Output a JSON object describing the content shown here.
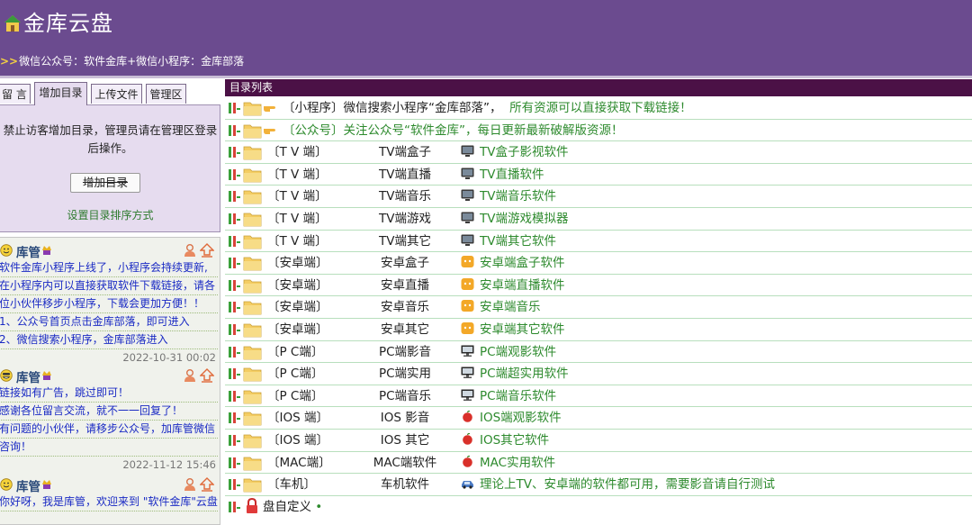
{
  "site": {
    "title": "金库云盘",
    "notice_arrows": ">>",
    "notice": "微信公众号：软件金库+微信小程序：金库部落"
  },
  "tabs": [
    {
      "label": "留 言"
    },
    {
      "label": "增加目录"
    },
    {
      "label": "上传文件"
    },
    {
      "label": "管理区"
    }
  ],
  "panel": {
    "message": "禁止访客增加目录，管理员请在管理区登录后操作。",
    "add_button": "增加目录",
    "sort_link": "设置目录排序方式"
  },
  "comments": [
    {
      "user": "库管",
      "lines": [
        "软件金库小程序上线了，小程序会持续更新,",
        "在小程序内可以直接获取软件下载链接，请各",
        "位小伙伴移步小程序，下载会更加方便！！",
        "1、公众号首页点击金库部落，即可进入",
        "2、微信搜索小程序，金库部落进入"
      ],
      "time": "2022-10-31 00:02"
    },
    {
      "user": "库管",
      "lines": [
        "链接如有广告，跳过即可！",
        "感谢各位留言交流，就不一一回复了！",
        "有问题的小伙伴，请移步公众号，加库管微信",
        "咨询！"
      ],
      "time": "2022-11-12 15:46"
    },
    {
      "user": "库管",
      "lines": [
        "你好呀，我是库管，欢迎来到 \"软件金库\"云盘"
      ],
      "time": ""
    }
  ],
  "list": {
    "header": "目录列表",
    "top_rows": [
      {
        "prefix": "〔小程序〕微信搜索小程序“金库部落”，",
        "suffix": "所有资源可以直接获取下载链接！"
      },
      {
        "prefix": "",
        "suffix": "〔公众号〕关注公众号“软件金库”，每日更新最新破解版资源！"
      }
    ],
    "rows": [
      {
        "cat": "〔T V 端〕",
        "name": "TV端盒子",
        "icon": "tv-icon",
        "desc": "TV盒子影视软件"
      },
      {
        "cat": "〔T V 端〕",
        "name": "TV端直播",
        "icon": "tv-icon",
        "desc": "TV直播软件"
      },
      {
        "cat": "〔T V 端〕",
        "name": "TV端音乐",
        "icon": "tv-icon",
        "desc": "TV端音乐软件"
      },
      {
        "cat": "〔T V 端〕",
        "name": "TV端游戏",
        "icon": "tv-icon",
        "desc": "TV端游戏模拟器"
      },
      {
        "cat": "〔T V 端〕",
        "name": "TV端其它",
        "icon": "tv-icon",
        "desc": "TV端其它软件"
      },
      {
        "cat": "〔安卓端〕",
        "name": "安卓盒子",
        "icon": "android-icon",
        "desc": "安卓端盒子软件"
      },
      {
        "cat": "〔安卓端〕",
        "name": "安卓直播",
        "icon": "android-icon",
        "desc": "安卓端直播软件"
      },
      {
        "cat": "〔安卓端〕",
        "name": "安卓音乐",
        "icon": "android-icon",
        "desc": "安卓端音乐"
      },
      {
        "cat": "〔安卓端〕",
        "name": "安卓其它",
        "icon": "android-icon",
        "desc": "安卓端其它软件"
      },
      {
        "cat": "〔P C端〕",
        "name": "PC端影音",
        "icon": "monitor-icon",
        "desc": "PC端观影软件"
      },
      {
        "cat": "〔P C端〕",
        "name": "PC端实用",
        "icon": "monitor-icon",
        "desc": "PC端超实用软件"
      },
      {
        "cat": "〔P C端〕",
        "name": "PC端音乐",
        "icon": "monitor-icon",
        "desc": "PC端音乐软件"
      },
      {
        "cat": "〔IOS 端〕",
        "name": "IOS 影音",
        "icon": "apple-icon",
        "desc": "IOS端观影软件"
      },
      {
        "cat": "〔IOS 端〕",
        "name": "IOS 其它",
        "icon": "apple-icon",
        "desc": "IOS其它软件"
      },
      {
        "cat": "〔MAC端〕",
        "name": "MAC端软件",
        "icon": "apple-icon",
        "desc": "MAC实用软件"
      },
      {
        "cat": "〔车机〕",
        "name": "车机软件",
        "icon": "car-icon",
        "desc": "理论上TV、安卓端的软件都可用，需要影音请自行测试"
      }
    ],
    "last_row": {
      "label": "盘自定义",
      "dot": "•"
    }
  }
}
